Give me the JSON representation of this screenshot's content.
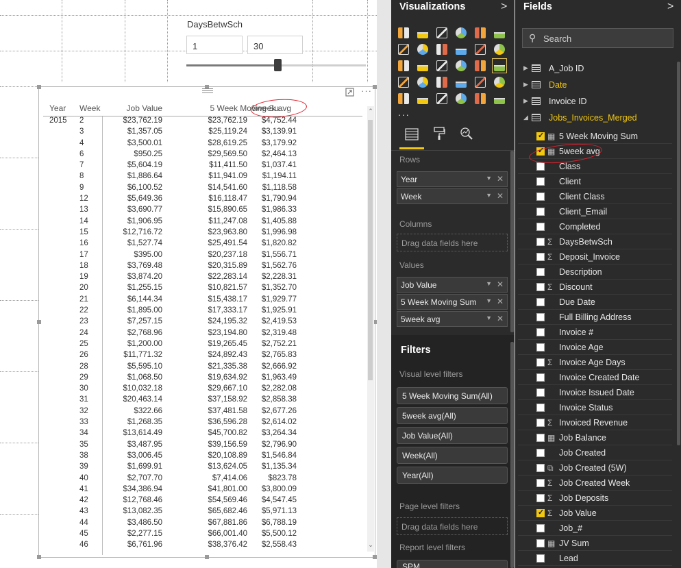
{
  "slicer": {
    "title": "DaysBetwSch",
    "min_value": "1",
    "max_value": "30",
    "slider_fraction": 0.52
  },
  "table": {
    "headers": {
      "year": "Year",
      "week": "Week",
      "job_value": "Job Value",
      "moving_sum": "5 Week Moving Su...",
      "avg": "5week avg"
    },
    "rows": [
      {
        "year": "2015",
        "week": "2",
        "job_value": "$23,762.19",
        "moving_sum": "$23,762.19",
        "avg": "$4,752.44"
      },
      {
        "year": "",
        "week": "3",
        "job_value": "$1,357.05",
        "moving_sum": "$25,119.24",
        "avg": "$3,139.91"
      },
      {
        "year": "",
        "week": "4",
        "job_value": "$3,500.01",
        "moving_sum": "$28,619.25",
        "avg": "$3,179.92"
      },
      {
        "year": "",
        "week": "6",
        "job_value": "$950.25",
        "moving_sum": "$29,569.50",
        "avg": "$2,464.13"
      },
      {
        "year": "",
        "week": "7",
        "job_value": "$5,604.19",
        "moving_sum": "$11,411.50",
        "avg": "$1,037.41"
      },
      {
        "year": "",
        "week": "8",
        "job_value": "$1,886.64",
        "moving_sum": "$11,941.09",
        "avg": "$1,194.11"
      },
      {
        "year": "",
        "week": "9",
        "job_value": "$6,100.52",
        "moving_sum": "$14,541.60",
        "avg": "$1,118.58"
      },
      {
        "year": "",
        "week": "12",
        "job_value": "$5,649.36",
        "moving_sum": "$16,118.47",
        "avg": "$1,790.94"
      },
      {
        "year": "",
        "week": "13",
        "job_value": "$3,690.77",
        "moving_sum": "$15,890.65",
        "avg": "$1,986.33"
      },
      {
        "year": "",
        "week": "14",
        "job_value": "$1,906.95",
        "moving_sum": "$11,247.08",
        "avg": "$1,405.88"
      },
      {
        "year": "",
        "week": "15",
        "job_value": "$12,716.72",
        "moving_sum": "$23,963.80",
        "avg": "$1,996.98"
      },
      {
        "year": "",
        "week": "16",
        "job_value": "$1,527.74",
        "moving_sum": "$25,491.54",
        "avg": "$1,820.82"
      },
      {
        "year": "",
        "week": "17",
        "job_value": "$395.00",
        "moving_sum": "$20,237.18",
        "avg": "$1,556.71"
      },
      {
        "year": "",
        "week": "18",
        "job_value": "$3,769.48",
        "moving_sum": "$20,315.89",
        "avg": "$1,562.76"
      },
      {
        "year": "",
        "week": "19",
        "job_value": "$3,874.20",
        "moving_sum": "$22,283.14",
        "avg": "$2,228.31"
      },
      {
        "year": "",
        "week": "20",
        "job_value": "$1,255.15",
        "moving_sum": "$10,821.57",
        "avg": "$1,352.70"
      },
      {
        "year": "",
        "week": "21",
        "job_value": "$6,144.34",
        "moving_sum": "$15,438.17",
        "avg": "$1,929.77"
      },
      {
        "year": "",
        "week": "22",
        "job_value": "$1,895.00",
        "moving_sum": "$17,333.17",
        "avg": "$1,925.91"
      },
      {
        "year": "",
        "week": "23",
        "job_value": "$7,257.15",
        "moving_sum": "$24,195.32",
        "avg": "$2,419.53"
      },
      {
        "year": "",
        "week": "24",
        "job_value": "$2,768.96",
        "moving_sum": "$23,194.80",
        "avg": "$2,319.48"
      },
      {
        "year": "",
        "week": "25",
        "job_value": "$1,200.00",
        "moving_sum": "$19,265.45",
        "avg": "$2,752.21"
      },
      {
        "year": "",
        "week": "26",
        "job_value": "$11,771.32",
        "moving_sum": "$24,892.43",
        "avg": "$2,765.83"
      },
      {
        "year": "",
        "week": "28",
        "job_value": "$5,595.10",
        "moving_sum": "$21,335.38",
        "avg": "$2,666.92"
      },
      {
        "year": "",
        "week": "29",
        "job_value": "$1,068.50",
        "moving_sum": "$19,634.92",
        "avg": "$1,963.49"
      },
      {
        "year": "",
        "week": "30",
        "job_value": "$10,032.18",
        "moving_sum": "$29,667.10",
        "avg": "$2,282.08"
      },
      {
        "year": "",
        "week": "31",
        "job_value": "$20,463.14",
        "moving_sum": "$37,158.92",
        "avg": "$2,858.38"
      },
      {
        "year": "",
        "week": "32",
        "job_value": "$322.66",
        "moving_sum": "$37,481.58",
        "avg": "$2,677.26"
      },
      {
        "year": "",
        "week": "33",
        "job_value": "$1,268.35",
        "moving_sum": "$36,596.28",
        "avg": "$2,614.02"
      },
      {
        "year": "",
        "week": "34",
        "job_value": "$13,614.49",
        "moving_sum": "$45,700.82",
        "avg": "$3,264.34"
      },
      {
        "year": "",
        "week": "35",
        "job_value": "$3,487.95",
        "moving_sum": "$39,156.59",
        "avg": "$2,796.90"
      },
      {
        "year": "",
        "week": "38",
        "job_value": "$3,006.45",
        "moving_sum": "$20,108.89",
        "avg": "$1,546.84"
      },
      {
        "year": "",
        "week": "39",
        "job_value": "$1,699.91",
        "moving_sum": "$13,624.05",
        "avg": "$1,135.34"
      },
      {
        "year": "",
        "week": "40",
        "job_value": "$2,707.70",
        "moving_sum": "$7,414.06",
        "avg": "$823.78"
      },
      {
        "year": "",
        "week": "41",
        "job_value": "$34,386.94",
        "moving_sum": "$41,801.00",
        "avg": "$3,800.09"
      },
      {
        "year": "",
        "week": "42",
        "job_value": "$12,768.46",
        "moving_sum": "$54,569.46",
        "avg": "$4,547.45"
      },
      {
        "year": "",
        "week": "43",
        "job_value": "$13,082.35",
        "moving_sum": "$65,682.46",
        "avg": "$5,971.13"
      },
      {
        "year": "",
        "week": "44",
        "job_value": "$3,486.50",
        "moving_sum": "$67,881.86",
        "avg": "$6,788.19"
      },
      {
        "year": "",
        "week": "45",
        "job_value": "$2,277.15",
        "moving_sum": "$66,001.40",
        "avg": "$5,500.12"
      },
      {
        "year": "",
        "week": "46",
        "job_value": "$6,761.96",
        "moving_sum": "$38,376.42",
        "avg": "$2,558.43"
      }
    ]
  },
  "visualizations": {
    "title": "Visualizations",
    "chevron": ">",
    "more": "...",
    "icons": [
      "stacked-bar-icon",
      "stacked-column-icon",
      "clustered-bar-icon",
      "clustered-column-icon",
      "100-bar-icon",
      "100-column-icon",
      "line-chart-icon",
      "area-chart-icon",
      "stacked-area-icon",
      "line-column-icon",
      "line-clustered-icon",
      "ribbon-chart-icon",
      "scatter-icon",
      "pie-chart-icon",
      "treemap-icon",
      "map-icon",
      "table-icon",
      "matrix-icon",
      "filled-map-icon",
      "funnel-icon",
      "gauge-icon",
      "multirow-card-icon",
      "card-icon",
      "kpi-icon",
      "slicer-icon",
      "donut-icon",
      "r-visual-icon",
      "shape-map-icon",
      "globe-icon",
      "table-alt-icon"
    ],
    "active_icon": "matrix-icon",
    "tabs": [
      "fields-tab",
      "format-tab",
      "analytics-tab"
    ],
    "rows_label": "Rows",
    "rows": [
      "Year",
      "Week"
    ],
    "columns_label": "Columns",
    "columns_placeholder": "Drag data fields here",
    "values_label": "Values",
    "values": [
      "Job Value",
      "5 Week Moving Sum",
      "5week avg"
    ],
    "filters_title": "Filters",
    "visual_filters_label": "Visual level filters",
    "visual_filters": [
      "5 Week Moving Sum(All)",
      "5week avg(All)",
      "Job Value(All)",
      "Week(All)",
      "Year(All)"
    ],
    "page_filters_label": "Page level filters",
    "page_filters_placeholder": "Drag data fields here",
    "report_filters_label": "Report level filters",
    "report_filter_partial": "SPM"
  },
  "fields": {
    "title": "Fields",
    "chevron": ">",
    "search_placeholder": "Search",
    "tables": [
      {
        "name": "A_Job ID",
        "expanded": false,
        "highlight": false
      },
      {
        "name": "Date",
        "expanded": false,
        "highlight": true
      },
      {
        "name": "Invoice ID",
        "expanded": false,
        "highlight": false
      },
      {
        "name": "Jobs_Invoices_Merged",
        "expanded": true,
        "highlight": true
      }
    ],
    "items": [
      {
        "name": "5 Week Moving Sum",
        "icon": "calc",
        "checked": true
      },
      {
        "name": "5week avg",
        "icon": "calc",
        "checked": true
      },
      {
        "name": "Class",
        "icon": "",
        "checked": false
      },
      {
        "name": "Client",
        "icon": "",
        "checked": false
      },
      {
        "name": "Client Class",
        "icon": "",
        "checked": false
      },
      {
        "name": "Client_Email",
        "icon": "",
        "checked": false
      },
      {
        "name": "Completed",
        "icon": "",
        "checked": false
      },
      {
        "name": "DaysBetwSch",
        "icon": "sigma",
        "checked": false
      },
      {
        "name": "Deposit_Invoice",
        "icon": "sigma",
        "checked": false
      },
      {
        "name": "Description",
        "icon": "",
        "checked": false
      },
      {
        "name": "Discount",
        "icon": "sigma",
        "checked": false
      },
      {
        "name": "Due Date",
        "icon": "",
        "checked": false
      },
      {
        "name": "Full Billing Address",
        "icon": "",
        "checked": false
      },
      {
        "name": "Invoice #",
        "icon": "",
        "checked": false
      },
      {
        "name": "Invoice Age",
        "icon": "",
        "checked": false
      },
      {
        "name": "Invoice Age Days",
        "icon": "sigma",
        "checked": false
      },
      {
        "name": "Invoice Created Date",
        "icon": "",
        "checked": false
      },
      {
        "name": "Invoice Issued Date",
        "icon": "",
        "checked": false
      },
      {
        "name": "Invoice Status",
        "icon": "",
        "checked": false
      },
      {
        "name": "Invoiced Revenue",
        "icon": "sigma",
        "checked": false
      },
      {
        "name": "Job Balance",
        "icon": "calc",
        "checked": false
      },
      {
        "name": "Job Created",
        "icon": "",
        "checked": false
      },
      {
        "name": "Job Created (5W)",
        "icon": "hierarchy",
        "checked": false
      },
      {
        "name": "Job Created Week",
        "icon": "sigma",
        "checked": false
      },
      {
        "name": "Job Deposits",
        "icon": "sigma",
        "checked": false
      },
      {
        "name": "Job Value",
        "icon": "sigma",
        "checked": true
      },
      {
        "name": "Job_#",
        "icon": "",
        "checked": false
      },
      {
        "name": "JV Sum",
        "icon": "calc",
        "checked": false
      },
      {
        "name": "Lead",
        "icon": "",
        "checked": false
      }
    ]
  },
  "colors": {
    "accent": "#f2c811",
    "annotation_red": "#e0202e",
    "pane_bg": "#2b2b2b"
  }
}
